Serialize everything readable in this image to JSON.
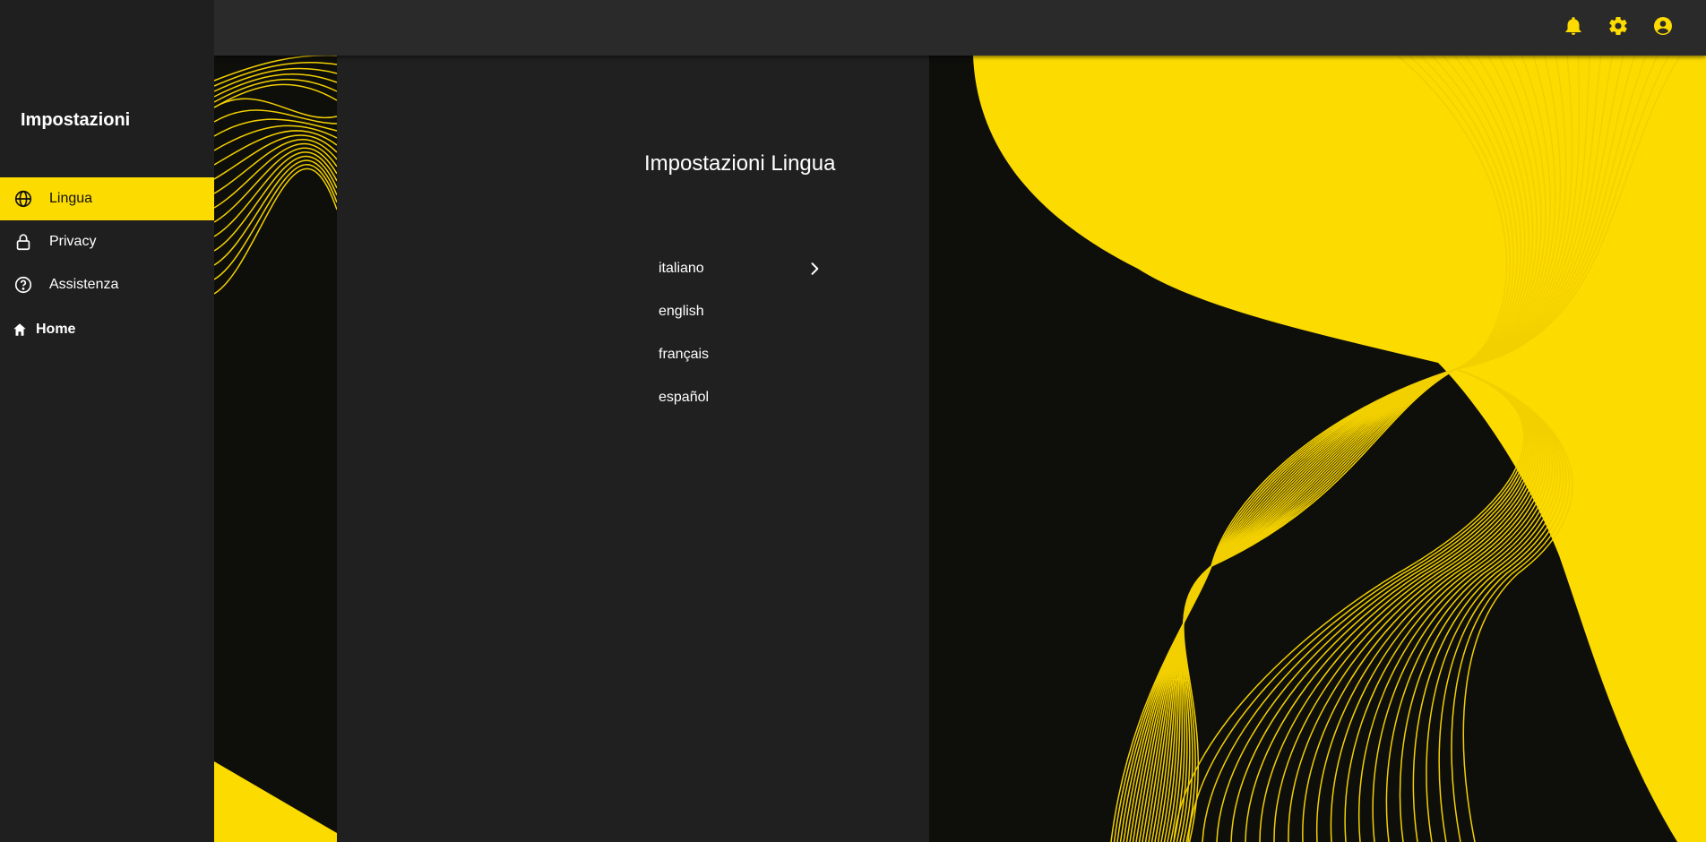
{
  "sidebar": {
    "title": "Impostazioni",
    "items": [
      {
        "label": "Lingua",
        "icon": "globe-icon",
        "active": true
      },
      {
        "label": "Privacy",
        "icon": "lock-icon",
        "active": false
      },
      {
        "label": "Assistenza",
        "icon": "help-circle-icon",
        "active": false
      }
    ],
    "home_label": "Home",
    "home_icon": "home-icon"
  },
  "topbar": {
    "icons": [
      "bell-icon",
      "gear-icon",
      "account-circle-icon"
    ]
  },
  "panel": {
    "title": "Impostazioni Lingua",
    "languages": [
      {
        "label": "italiano",
        "selected": true
      },
      {
        "label": "english",
        "selected": false
      },
      {
        "label": "français",
        "selected": false
      },
      {
        "label": "español",
        "selected": false
      }
    ]
  },
  "colors": {
    "accent": "#fcdb00",
    "sidebar_bg": "#1f1f1f",
    "topbar_bg": "#2a2a2a",
    "panel_bg": "#202020",
    "page_bg": "#0e0e0b"
  }
}
